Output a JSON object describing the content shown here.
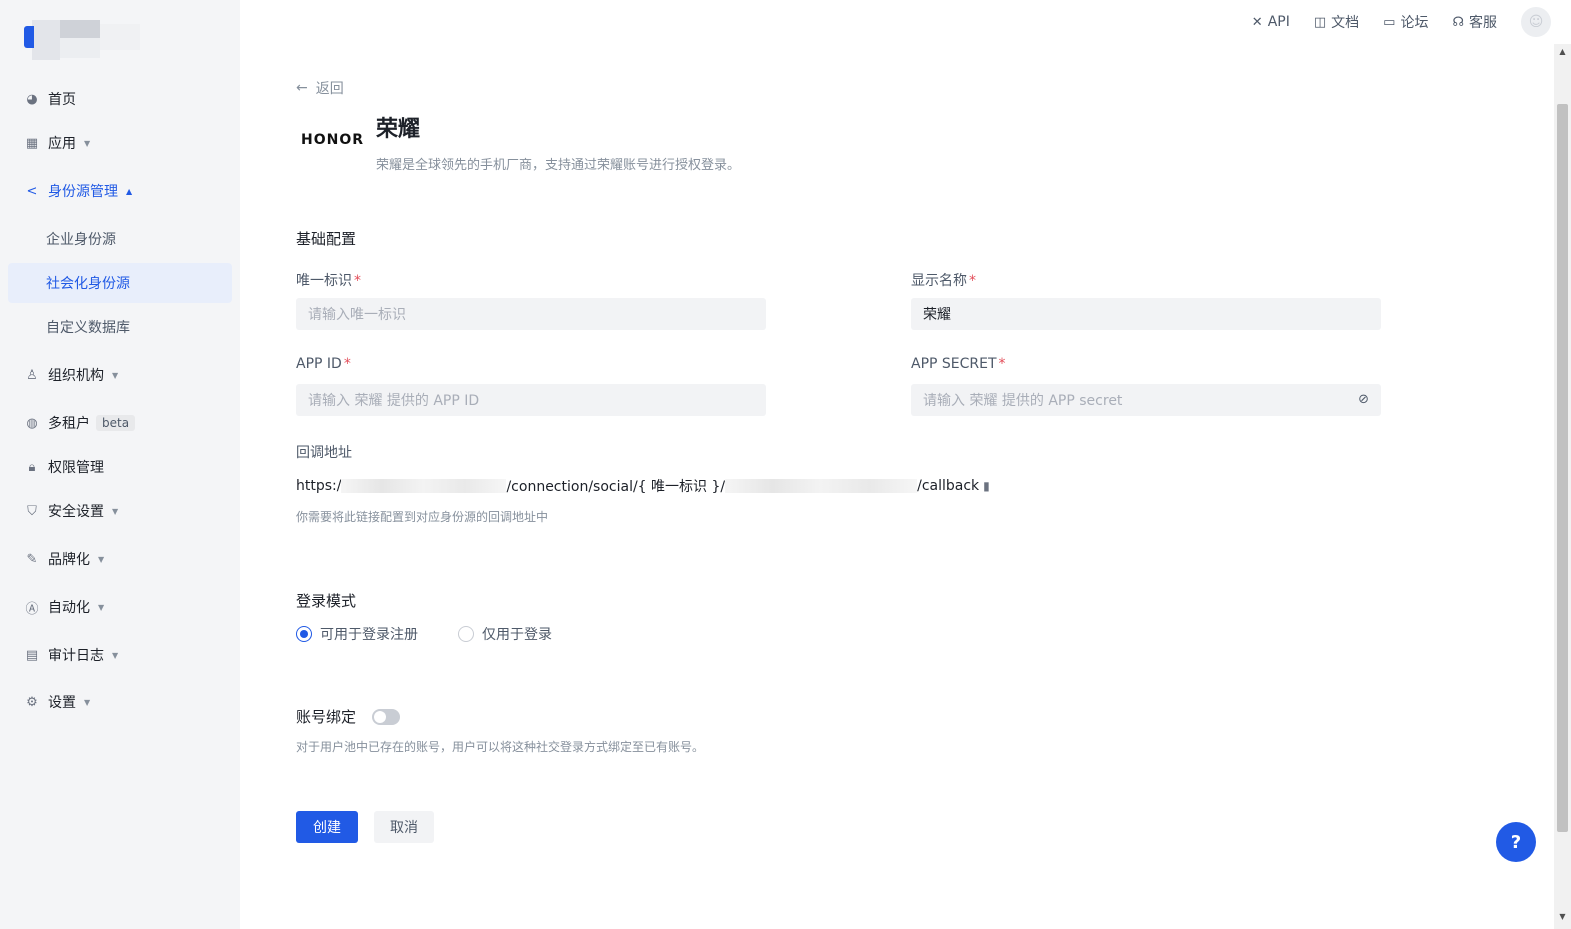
{
  "sidebar": {
    "items": [
      {
        "label": "首页",
        "icon": "pie-chart-icon"
      },
      {
        "label": "应用",
        "icon": "apps-grid-icon",
        "caret": "▼"
      },
      {
        "label": "身份源管理",
        "icon": "share-icon",
        "caret": "▲"
      },
      {
        "label": "企业身份源"
      },
      {
        "label": "社会化身份源"
      },
      {
        "label": "自定义数据库"
      },
      {
        "label": "组织机构",
        "icon": "org-tree-icon",
        "caret": "▼"
      },
      {
        "label": "多租户",
        "icon": "tenant-icon",
        "badge": "beta"
      },
      {
        "label": "权限管理",
        "icon": "lock-icon"
      },
      {
        "label": "安全设置",
        "icon": "shield-icon",
        "caret": "▼"
      },
      {
        "label": "品牌化",
        "icon": "brush-icon",
        "caret": "▼"
      },
      {
        "label": "自动化",
        "icon": "automation-icon",
        "caret": "▼"
      },
      {
        "label": "审计日志",
        "icon": "log-icon",
        "caret": "▼"
      },
      {
        "label": "设置",
        "icon": "gear-icon",
        "caret": "▼"
      }
    ]
  },
  "topbar": {
    "api": "API",
    "docs": "文档",
    "forum": "论坛",
    "support": "客服"
  },
  "page": {
    "back": "返回",
    "provider_logo": "HONOR",
    "title": "荣耀",
    "description": "荣耀是全球领先的手机厂商，支持通过荣耀账号进行授权登录。"
  },
  "form": {
    "section_basic": "基础配置",
    "identifier_label": "唯一标识",
    "identifier_placeholder": "请输入唯一标识",
    "display_name_label": "显示名称",
    "display_name_value": "荣耀",
    "app_id_label": "APP ID",
    "app_id_placeholder": "请输入 荣耀 提供的 APP ID",
    "app_secret_label": "APP SECRET",
    "app_secret_placeholder": "请输入 荣耀 提供的 APP secret",
    "required_mark": "*",
    "callback_label": "回调地址",
    "callback_prefix": "https:/",
    "callback_middle": "/connection/social/{ 唯一标识 }/",
    "callback_suffix": "/callback",
    "callback_hint": "你需要将此链接配置到对应身份源的回调地址中",
    "login_mode_label": "登录模式",
    "login_mode_options": [
      "可用于登录注册",
      "仅用于登录"
    ],
    "login_mode_selected": "可用于登录注册",
    "account_binding_label": "账号绑定",
    "account_binding_enabled": false,
    "account_binding_hint": "对于用户池中已存在的账号，用户可以将这种社交登录方式绑定至已有账号。"
  },
  "actions": {
    "create": "创建",
    "cancel": "取消"
  },
  "help": "?",
  "colors": {
    "primary": "#215ae5",
    "required": "#e34d59"
  }
}
